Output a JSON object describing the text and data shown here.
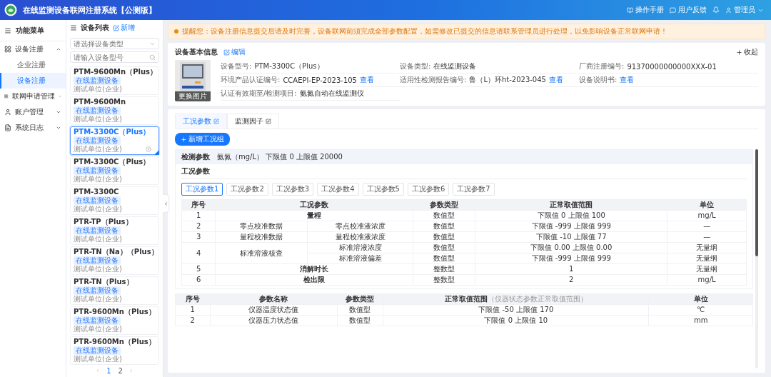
{
  "header": {
    "title": "在线监测设备联网注册系统【公测版】",
    "actions": [
      {
        "kind": "link",
        "label": "操作手册"
      },
      {
        "kind": "link",
        "label": "用户反馈"
      },
      {
        "kind": "bell"
      },
      {
        "kind": "user",
        "label": "管理员"
      }
    ]
  },
  "sidebar": {
    "title": "功能菜单",
    "items": [
      {
        "label": "设备注册",
        "expanded": true,
        "children": [
          {
            "label": "企业注册",
            "selected": false
          },
          {
            "label": "设备注册",
            "selected": true
          }
        ]
      },
      {
        "label": "联网申请管理",
        "expanded": false
      },
      {
        "label": "账户管理",
        "expanded": false
      },
      {
        "label": "系统日志",
        "expanded": false
      }
    ]
  },
  "device_list": {
    "title": "设备列表",
    "add": "新增",
    "type_placeholder": "请选择设备类型",
    "search_placeholder": "请输入设备型号",
    "items": [
      {
        "model": "PTM-9600Mn（Plus）",
        "tag": "在线监测设备",
        "company": "测试单位(企业)",
        "selected": false
      },
      {
        "model": "PTM-9600Mn",
        "tag": "在线监测设备",
        "company": "测试单位(企业)",
        "selected": false
      },
      {
        "model": "PTM-3300C（Plus）",
        "tag": "在线监测设备",
        "company": "测试单位(企业)",
        "selected": true
      },
      {
        "model": "PTM-3300C（Plus）",
        "tag": "在线监测设备",
        "company": "测试单位(企业)",
        "selected": false
      },
      {
        "model": "PTM-3300C",
        "tag": "在线监测设备",
        "company": "测试单位(企业)",
        "selected": false
      },
      {
        "model": "PTR-TP（Plus）",
        "tag": "在线监测设备",
        "company": "测试单位(企业)",
        "selected": false
      },
      {
        "model": "PTR-TN（Na）（Plus）",
        "tag": "在线监测设备",
        "company": "测试单位(企业)",
        "selected": false
      },
      {
        "model": "PTR-TN（Plus）",
        "tag": "在线监测设备",
        "company": "测试单位(企业)",
        "selected": false
      },
      {
        "model": "PTR-9600Mn（Plus）",
        "tag": "在线监测设备",
        "company": "测试单位(企业)",
        "selected": false
      },
      {
        "model": "PTR-9600Mn（Plus）",
        "tag": "在线监测设备",
        "company": "测试单位(企业)",
        "selected": false
      }
    ],
    "pages": [
      {
        "label": "1",
        "selected": true
      },
      {
        "label": "2",
        "selected": false
      }
    ]
  },
  "notice": "提醒您：设备注册信息提交后请及时完善，设备联网前须完成全部参数配置，如需修改已提交的信息请联系管理员进行处理，以免影响设备正常联网申请！",
  "info": {
    "title": "设备基本信息",
    "edit": "编辑",
    "collapse": "收起",
    "image_button": "更换图片",
    "fields": [
      {
        "label": "设备型号:",
        "value": "PTM-3300C（Plus）"
      },
      {
        "label": "设备类型:",
        "value": "在线监测设备"
      },
      {
        "label": "厂商注册编号:",
        "value": "91370000000000XXX-01"
      },
      {
        "label": "环境产品认证编号:",
        "value": "CCAEPI-EP-2023-105",
        "link": "查看"
      },
      {
        "label": "适用性检测报告编号:",
        "value": "鲁（L）环ht-2023-045",
        "link": "查看"
      },
      {
        "label": "设备说明书:",
        "link": "查看"
      },
      {
        "label": "认证有效期至/检测项目:",
        "value": "氨氮自动在线监测仪"
      }
    ]
  },
  "tabs": [
    {
      "label": "工况参数",
      "selected": true
    },
    {
      "label": "监测因子",
      "selected": false
    }
  ],
  "add_group": "新增工况组",
  "detection": {
    "label": "检测参数",
    "value": "氨氮（mg/L） 下限值 0 上限值 20000"
  },
  "group_title": "工况参数",
  "group_tabs": [
    {
      "label": "工况参数1",
      "selected": true
    },
    {
      "label": "工况参数2",
      "selected": false
    },
    {
      "label": "工况参数3",
      "selected": false
    },
    {
      "label": "工况参数4",
      "selected": false
    },
    {
      "label": "工况参数5",
      "selected": false
    },
    {
      "label": "工况参数6",
      "selected": false
    },
    {
      "label": "工况参数7",
      "selected": false
    }
  ],
  "params_table": {
    "columns": [
      "序号",
      "工况参数",
      "参数类型",
      "正常取值范围",
      "单位"
    ],
    "rows": [
      {
        "no": "1",
        "name": "量程",
        "items": [
          {
            "type": "数值型",
            "range": "下限值 0  上限值 100",
            "unit": "mg/L"
          }
        ]
      },
      {
        "no": "2",
        "name": "零点校准数据",
        "items": [
          {
            "name": "零点校准液浓度",
            "type": "数值型",
            "range": "下限值 -999  上限值 999",
            "unit": "—"
          }
        ]
      },
      {
        "no": "3",
        "name": "量程校准数据",
        "items": [
          {
            "name": "量程校准液浓度",
            "type": "数值型",
            "range": "下限值 -10  上限值 77",
            "unit": "—"
          }
        ]
      },
      {
        "no": "4",
        "name": "标准溶液核查",
        "items": [
          {
            "name": "标准溶液浓度",
            "type": "数值型",
            "range": "下限值 0.00  上限值 0.00",
            "unit": "无量纲"
          },
          {
            "name": "标准溶液偏差",
            "type": "数值型",
            "range": "下限值 -999  上限值 999",
            "unit": "无量纲"
          }
        ]
      },
      {
        "no": "5",
        "name": "消解时长",
        "items": [
          {
            "type": "整数型",
            "range": "1",
            "unit": "无量纲"
          }
        ]
      },
      {
        "no": "6",
        "name": "检出限",
        "items": [
          {
            "type": "整数型",
            "range": "2",
            "unit": "mg/L"
          }
        ]
      }
    ]
  },
  "state_table": {
    "columns": [
      "序号",
      "参数名称",
      "参数类型",
      "正常取值范围",
      "单位"
    ],
    "range_note": "（仪器状态参数正常取值范围）",
    "rows": [
      {
        "no": "1",
        "name": "仪器温度状态值",
        "type": "数值型",
        "range": "下限值 -50  上限值 170",
        "unit": "℃"
      },
      {
        "no": "2",
        "name": "仪器压力状态值",
        "type": "数值型",
        "range": "下限值 0  上限值 10",
        "unit": "mm"
      }
    ]
  }
}
